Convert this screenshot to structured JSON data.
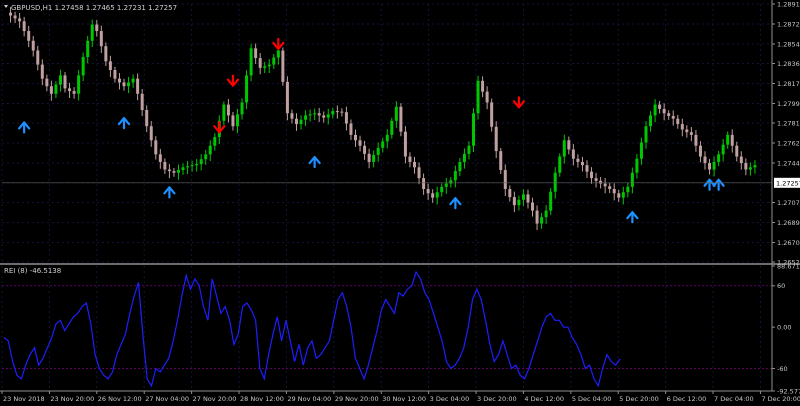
{
  "chart_data": [
    {
      "type": "candlestick",
      "header": "GBPUSD,H1  1.27458 1.27465 1.27231 1.27257",
      "ylim": [
        1.26525,
        1.2891
      ],
      "y_ticks": [
        "1.28910",
        "1.28725",
        "1.28540",
        "1.28360",
        "1.28175",
        "1.27990",
        "1.27810",
        "1.27625",
        "1.27440",
        "1.27257",
        "1.27075",
        "1.26890",
        "1.26705",
        "1.26525"
      ],
      "current_price": "1.27257",
      "x_ticks": [
        "23 Nov 2018",
        "23 Nov 20:00",
        "26 Nov 12:00",
        "27 Nov 04:00",
        "27 Nov 20:00",
        "28 Nov 12:00",
        "29 Nov 04:00",
        "29 Nov 20:00",
        "30 Nov 12:00",
        "3 Dec 04:00",
        "3 Dec 20:00",
        "4 Dec 12:00",
        "5 Dec 04:00",
        "5 Dec 20:00",
        "6 Dec 12:00",
        "7 Dec 04:00",
        "7 Dec 20:00"
      ],
      "price_path": [
        [
          0,
          1.2883
        ],
        [
          3,
          1.2875
        ],
        [
          6,
          1.2848
        ],
        [
          8,
          1.2822
        ],
        [
          10,
          1.2808
        ],
        [
          12,
          1.2825
        ],
        [
          13,
          1.2813
        ],
        [
          15,
          1.2808
        ],
        [
          17,
          1.2842
        ],
        [
          19,
          1.2872
        ],
        [
          20,
          1.2866
        ],
        [
          22,
          1.2838
        ],
        [
          24,
          1.2822
        ],
        [
          26,
          1.2815
        ],
        [
          28,
          1.2822
        ],
        [
          29,
          1.2808
        ],
        [
          31,
          1.2778
        ],
        [
          33,
          1.2752
        ],
        [
          35,
          1.2738
        ],
        [
          37,
          1.2735
        ],
        [
          39,
          1.274
        ],
        [
          42,
          1.2743
        ],
        [
          44,
          1.2752
        ],
        [
          46,
          1.2768
        ],
        [
          48,
          1.2798
        ],
        [
          50,
          1.2778
        ],
        [
          52,
          1.28
        ],
        [
          54,
          1.285
        ],
        [
          56,
          1.2832
        ],
        [
          58,
          1.2835
        ],
        [
          60,
          1.2848
        ],
        [
          62,
          1.279
        ],
        [
          64,
          1.278
        ],
        [
          66,
          1.2788
        ],
        [
          68,
          1.279
        ],
        [
          70,
          1.2786
        ],
        [
          72,
          1.2792
        ],
        [
          74,
          1.2791
        ],
        [
          76,
          1.277
        ],
        [
          78,
          1.276
        ],
        [
          80,
          1.2745
        ],
        [
          82,
          1.2758
        ],
        [
          84,
          1.277
        ],
        [
          86,
          1.2796
        ],
        [
          88,
          1.275
        ],
        [
          90,
          1.274
        ],
        [
          92,
          1.272
        ],
        [
          94,
          1.2712
        ],
        [
          96,
          1.2722
        ],
        [
          98,
          1.2728
        ],
        [
          100,
          1.2745
        ],
        [
          102,
          1.276
        ],
        [
          104,
          1.282
        ],
        [
          106,
          1.28
        ],
        [
          108,
          1.2755
        ],
        [
          110,
          1.272
        ],
        [
          112,
          1.2705
        ],
        [
          114,
          1.2715
        ],
        [
          116,
          1.27
        ],
        [
          117,
          1.2688
        ],
        [
          119,
          1.27
        ],
        [
          121,
          1.2735
        ],
        [
          123,
          1.2765
        ],
        [
          125,
          1.2748
        ],
        [
          127,
          1.2742
        ],
        [
          129,
          1.273
        ],
        [
          131,
          1.2725
        ],
        [
          133,
          1.272
        ],
        [
          135,
          1.2712
        ],
        [
          137,
          1.2722
        ],
        [
          139,
          1.2748
        ],
        [
          141,
          1.2778
        ],
        [
          143,
          1.2798
        ],
        [
          145,
          1.279
        ],
        [
          147,
          1.2785
        ],
        [
          149,
          1.2775
        ],
        [
          151,
          1.277
        ],
        [
          153,
          1.275
        ],
        [
          155,
          1.2738
        ],
        [
          157,
          1.2752
        ],
        [
          159,
          1.277
        ],
        [
          161,
          1.275
        ],
        [
          163,
          1.2738
        ],
        [
          165,
          1.2742
        ]
      ],
      "buy_signals": [
        {
          "bar": 4,
          "price": 1.2788
        },
        {
          "bar": 26,
          "price": 1.2792
        },
        {
          "bar": 36,
          "price": 1.2728
        },
        {
          "bar": 68,
          "price": 1.2756
        },
        {
          "bar": 99,
          "price": 1.2718
        },
        {
          "bar": 138,
          "price": 1.2705
        },
        {
          "bar": 155,
          "price": 1.2735
        },
        {
          "bar": 157,
          "price": 1.2735
        }
      ],
      "sell_signals": [
        {
          "bar": 47,
          "price": 1.2766
        },
        {
          "bar": 50,
          "price": 1.2809
        },
        {
          "bar": 60,
          "price": 1.2843
        },
        {
          "bar": 113,
          "price": 1.2789
        }
      ],
      "colors": {
        "up": "#00c800",
        "down": "#c0a0a0",
        "buy": "#1e90ff",
        "sell": "#ff0000",
        "grid": "#1a1a2e",
        "axis": "#808080"
      }
    },
    {
      "type": "line",
      "title": "REI (8) -46.5138",
      "ylim": [
        -92.5771,
        88.6719
      ],
      "y_ticks": [
        "88.6719",
        "60",
        "0.00",
        "-60",
        "-92.5771"
      ],
      "levels": [
        60,
        -60
      ],
      "values": [
        -15,
        -20,
        -50,
        -70,
        -75,
        -55,
        -40,
        -30,
        -55,
        -45,
        -30,
        -15,
        5,
        10,
        -5,
        5,
        15,
        20,
        30,
        35,
        5,
        -40,
        -60,
        -70,
        -75,
        -65,
        -40,
        -25,
        -10,
        20,
        45,
        65,
        -10,
        -75,
        -85,
        -60,
        -65,
        -55,
        -45,
        -20,
        10,
        45,
        75,
        55,
        70,
        60,
        30,
        10,
        70,
        45,
        20,
        30,
        10,
        -25,
        -10,
        30,
        35,
        25,
        10,
        -60,
        -75,
        -40,
        -10,
        15,
        -20,
        10,
        -20,
        -50,
        -25,
        -55,
        -30,
        -20,
        -45,
        -40,
        -30,
        -20,
        10,
        40,
        50,
        30,
        0,
        -45,
        -60,
        -75,
        -55,
        -30,
        -5,
        25,
        40,
        30,
        20,
        50,
        45,
        55,
        60,
        80,
        70,
        50,
        40,
        20,
        0,
        -20,
        -50,
        -60,
        -55,
        -45,
        -30,
        0,
        40,
        55,
        40,
        10,
        -25,
        -50,
        -40,
        -20,
        -40,
        -60,
        -55,
        -70,
        -75,
        -60,
        -40,
        -20,
        0,
        15,
        20,
        10,
        10,
        0,
        0,
        -15,
        -25,
        -40,
        -60,
        -55,
        -75,
        -85,
        -60,
        -40,
        -50,
        -55,
        -46
      ]
    }
  ]
}
